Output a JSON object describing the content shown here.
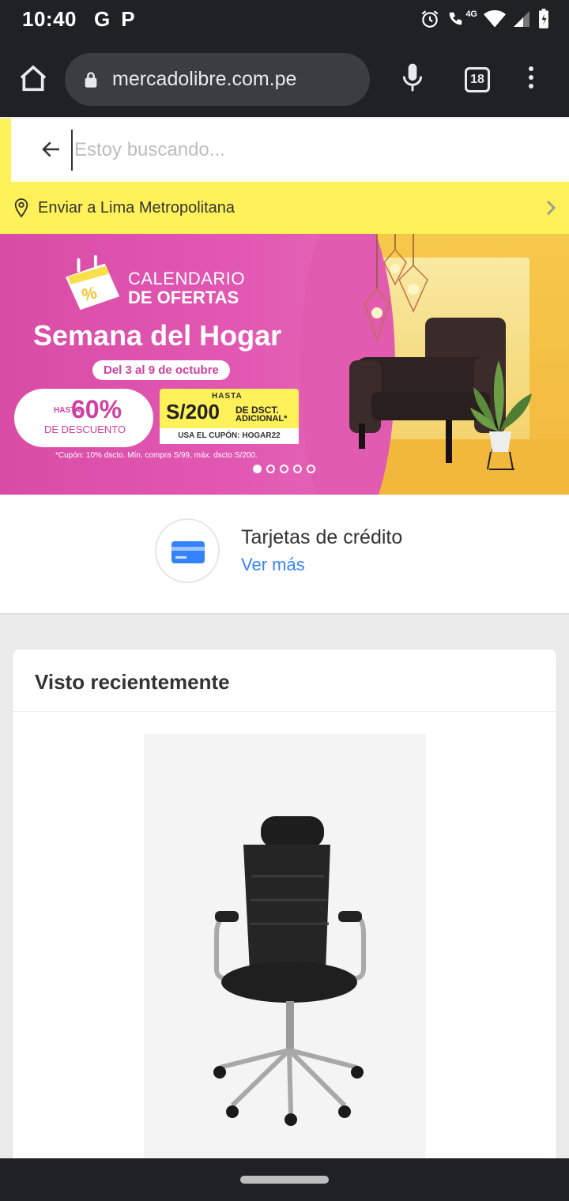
{
  "status_bar": {
    "time": "10:40",
    "notif_1": "G",
    "notif_2": "P",
    "network": "4G"
  },
  "browser": {
    "url": "mercadolibre.com.pe",
    "tab_count": "18"
  },
  "search": {
    "placeholder": "Estoy buscando..."
  },
  "location": {
    "label": "Enviar a Lima Metropolitana"
  },
  "banner": {
    "calendar_line1": "CALENDARIO",
    "calendar_line2": "DE OFERTAS",
    "headline": "Semana del Hogar",
    "dates": "Del 3 al 9 de octubre",
    "badge_hasta": "HASTA",
    "badge_percent": "60%",
    "badge_desc": "DE DESCUENTO",
    "coupon_hasta": "HASTA",
    "coupon_amount": "S/200",
    "coupon_line1": "DE DSCT.",
    "coupon_line2": "ADICIONAL*",
    "coupon_code": "USA EL CUPÓN: HOGAR22",
    "note": "*Cupón: 10% dscto. Mín. compra S/99, máx. dscto S/200.",
    "slide_count": 5,
    "active_slide": 1
  },
  "credit_cards": {
    "title": "Tarjetas de crédito",
    "link": "Ver más"
  },
  "recent": {
    "title": "Visto recientemente"
  },
  "colors": {
    "brand_yellow": "#fff159",
    "link_blue": "#3483fa",
    "banner_pink": "#e157b2"
  }
}
